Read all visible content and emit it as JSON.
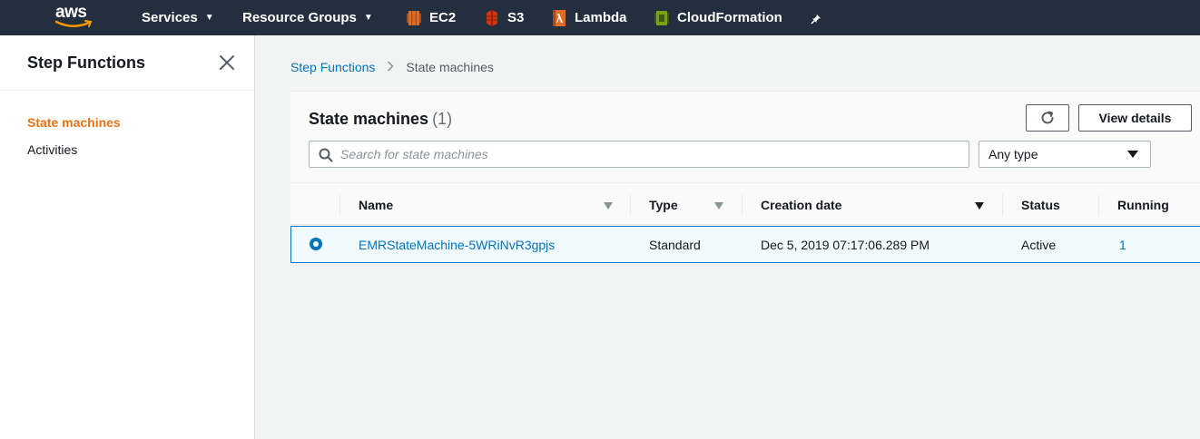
{
  "topnav": {
    "logo_text": "aws",
    "services_label": "Services",
    "resource_groups_label": "Resource Groups",
    "shortcuts": [
      {
        "label": "EC2",
        "icon": "ec2-icon",
        "color": "#e36b23"
      },
      {
        "label": "S3",
        "icon": "s3-icon",
        "color": "#d13212"
      },
      {
        "label": "Lambda",
        "icon": "lambda-icon",
        "color": "#e36b23"
      },
      {
        "label": "CloudFormation",
        "icon": "cloudformation-icon",
        "color": "#7aa116"
      }
    ],
    "pin_icon": "pin-icon"
  },
  "sidebar": {
    "title": "Step Functions",
    "items": [
      {
        "label": "State machines",
        "active": true
      },
      {
        "label": "Activities",
        "active": false
      }
    ]
  },
  "breadcrumb": {
    "root": "Step Functions",
    "current": "State machines"
  },
  "panel": {
    "title": "State machines",
    "count": "(1)",
    "view_details_label": "View details",
    "search_placeholder": "Search for state machines",
    "type_filter": "Any type"
  },
  "table": {
    "columns": [
      "Name",
      "Type",
      "Creation date",
      "Status",
      "Running"
    ],
    "rows": [
      {
        "name": "EMRStateMachine-5WRiNvR3gpjs",
        "type": "Standard",
        "creation_date": "Dec 5, 2019 07:17:06.289 PM",
        "status": "Active",
        "running": "1",
        "selected": true
      }
    ]
  },
  "colors": {
    "nav_bg": "#232f3e",
    "accent_orange": "#ec7211",
    "link_blue": "#0073bb"
  }
}
